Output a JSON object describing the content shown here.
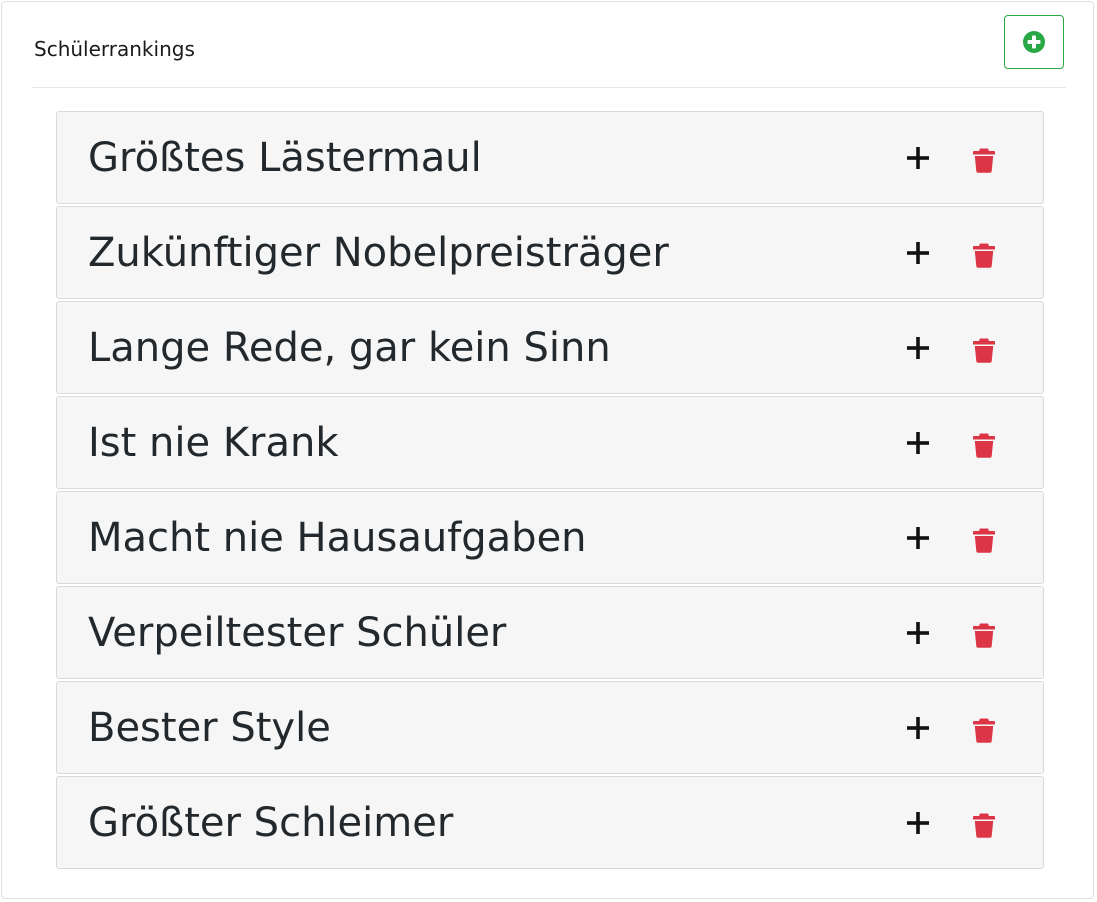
{
  "header": {
    "title": "Schülerrankings",
    "add_button_icon": "plus-circle-icon",
    "accent_color": "#28a745"
  },
  "rankings": [
    {
      "title": "Größtes Lästermaul"
    },
    {
      "title": "Zukünftiger Nobelpreisträger"
    },
    {
      "title": "Lange Rede, gar kein Sinn"
    },
    {
      "title": "Ist nie Krank"
    },
    {
      "title": "Macht nie Hausaufgaben"
    },
    {
      "title": "Verpeiltester Schüler"
    },
    {
      "title": "Bester Style"
    },
    {
      "title": "Größter Schleimer"
    }
  ],
  "item_icons": {
    "add": "plus-icon",
    "delete": "trash-icon",
    "delete_color": "#dc3545"
  }
}
